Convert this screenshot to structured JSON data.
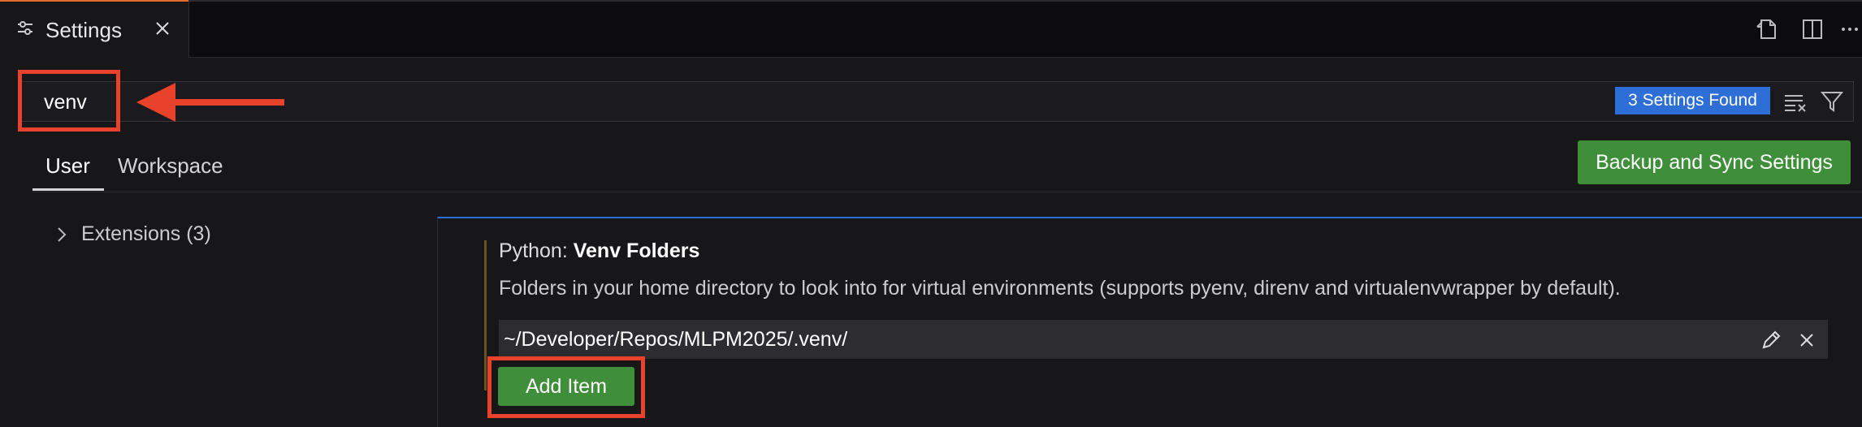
{
  "editor": {
    "tab_title": "Settings",
    "icons": {
      "tab": "settings-sliders-icon",
      "close": "close-icon",
      "open_json": "open-settings-json-icon",
      "split": "split-editor-icon",
      "more": "more-actions-icon"
    }
  },
  "search": {
    "value": "venv",
    "result_badge": "3 Settings Found",
    "icons": {
      "clear": "clear-filter-icon",
      "filter": "filter-icon"
    }
  },
  "scopes": {
    "tabs": [
      {
        "label": "User",
        "active": true
      },
      {
        "label": "Workspace",
        "active": false
      }
    ],
    "sync_button": "Backup and Sync Settings"
  },
  "toc": {
    "items": [
      {
        "label": "Extensions (3)",
        "expanded": false
      }
    ]
  },
  "setting": {
    "category": "Python: ",
    "name": "Venv Folders",
    "description": "Folders in your home directory to look into for virtual environments (supports pyenv, direnv and virtualenvwrapper by default).",
    "items": [
      "~/Developer/Repos/MLPM2025/.venv/"
    ],
    "add_button": "Add Item",
    "icons": {
      "edit": "edit-pencil-icon",
      "remove": "remove-item-icon"
    }
  },
  "annotations": {
    "color": "#e8412c",
    "highlighted": [
      "search-input",
      "add-item-button"
    ],
    "arrow_points_to": "search-input"
  },
  "colors": {
    "accent_blue": "#2d6fd6",
    "button_green": "#3f8f3a",
    "modified_bar": "#6b5320"
  }
}
